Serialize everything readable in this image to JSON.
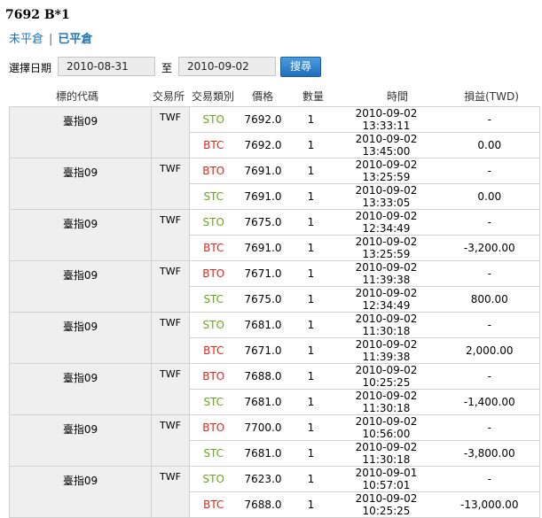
{
  "header": {
    "title": "7692 B*1"
  },
  "tabs": {
    "open": "未平倉",
    "closed": "已平倉"
  },
  "filter": {
    "label": "選擇日期",
    "start": "2010-08-31",
    "to": "至",
    "end": "2010-09-02",
    "search": "搜尋"
  },
  "columns": {
    "symbol": "標的代碼",
    "exchange": "交易所",
    "type": "交易類別",
    "price": "價格",
    "qty": "數量",
    "time": "時間",
    "pl": "損益(TWD)"
  },
  "colors": {
    "buy_to": "#e0251b",
    "sell_to": "#6aa51b",
    "accent": "#1f77b8"
  },
  "groups": [
    {
      "symbol": "臺指09",
      "exchange": "TWF",
      "rows": [
        {
          "type": "STO",
          "price": "7692.0",
          "qty": "1",
          "time": "2010-09-02 13:33:11",
          "pl": "-"
        },
        {
          "type": "BTC",
          "price": "7692.0",
          "qty": "1",
          "time": "2010-09-02 13:45:00",
          "pl": "0.00"
        }
      ]
    },
    {
      "symbol": "臺指09",
      "exchange": "TWF",
      "rows": [
        {
          "type": "BTO",
          "price": "7691.0",
          "qty": "1",
          "time": "2010-09-02 13:25:59",
          "pl": "-"
        },
        {
          "type": "STC",
          "price": "7691.0",
          "qty": "1",
          "time": "2010-09-02 13:33:05",
          "pl": "0.00"
        }
      ]
    },
    {
      "symbol": "臺指09",
      "exchange": "TWF",
      "rows": [
        {
          "type": "STO",
          "price": "7675.0",
          "qty": "1",
          "time": "2010-09-02 12:34:49",
          "pl": "-"
        },
        {
          "type": "BTC",
          "price": "7691.0",
          "qty": "1",
          "time": "2010-09-02 13:25:59",
          "pl": "-3,200.00"
        }
      ]
    },
    {
      "symbol": "臺指09",
      "exchange": "TWF",
      "rows": [
        {
          "type": "BTO",
          "price": "7671.0",
          "qty": "1",
          "time": "2010-09-02 11:39:38",
          "pl": "-"
        },
        {
          "type": "STC",
          "price": "7675.0",
          "qty": "1",
          "time": "2010-09-02 12:34:49",
          "pl": "800.00"
        }
      ]
    },
    {
      "symbol": "臺指09",
      "exchange": "TWF",
      "rows": [
        {
          "type": "STO",
          "price": "7681.0",
          "qty": "1",
          "time": "2010-09-02 11:30:18",
          "pl": "-"
        },
        {
          "type": "BTC",
          "price": "7671.0",
          "qty": "1",
          "time": "2010-09-02 11:39:38",
          "pl": "2,000.00"
        }
      ]
    },
    {
      "symbol": "臺指09",
      "exchange": "TWF",
      "rows": [
        {
          "type": "BTO",
          "price": "7688.0",
          "qty": "1",
          "time": "2010-09-02 10:25:25",
          "pl": "-"
        },
        {
          "type": "STC",
          "price": "7681.0",
          "qty": "1",
          "time": "2010-09-02 11:30:18",
          "pl": "-1,400.00"
        }
      ]
    },
    {
      "symbol": "臺指09",
      "exchange": "TWF",
      "rows": [
        {
          "type": "BTO",
          "price": "7700.0",
          "qty": "1",
          "time": "2010-09-02 10:56:00",
          "pl": "-"
        },
        {
          "type": "STC",
          "price": "7681.0",
          "qty": "1",
          "time": "2010-09-02 11:30:18",
          "pl": "-3,800.00"
        }
      ]
    },
    {
      "symbol": "臺指09",
      "exchange": "TWF",
      "rows": [
        {
          "type": "STO",
          "price": "7623.0",
          "qty": "1",
          "time": "2010-09-01 10:57:01",
          "pl": "-"
        },
        {
          "type": "BTC",
          "price": "7688.0",
          "qty": "1",
          "time": "2010-09-02 10:25:25",
          "pl": "-13,000.00"
        }
      ]
    }
  ]
}
